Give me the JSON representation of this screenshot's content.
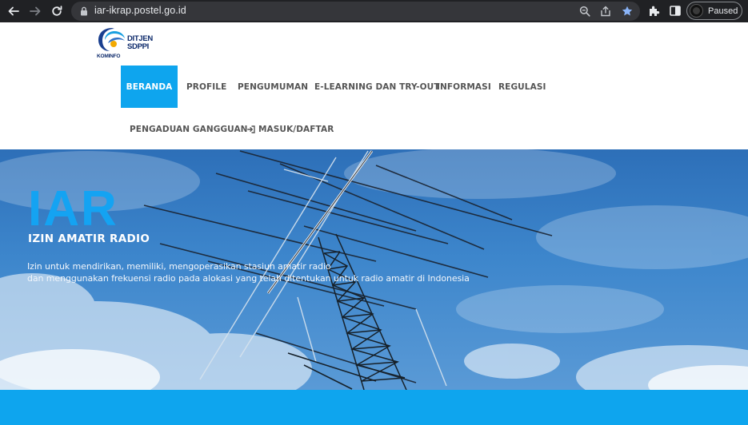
{
  "browser": {
    "url": "iar-ikrap.postel.go.id",
    "profile_status": "Paused"
  },
  "brand": {
    "line1": "DITJEN",
    "line2": "SDPPI",
    "org": "KOMINFO"
  },
  "nav": {
    "items": [
      {
        "label": "BERANDA",
        "active": true
      },
      {
        "label": "PROFILE"
      },
      {
        "label": "PENGUMUMAN"
      },
      {
        "label": "E-LEARNING DAN TRY-OUT"
      },
      {
        "label": "INFORMASI"
      },
      {
        "label": "REGULASI"
      },
      {
        "label": "PENGADUAN GANGGUAN"
      },
      {
        "label": "MASUK/DAFTAR",
        "icon": "sign-in-icon"
      }
    ]
  },
  "hero": {
    "title": "IAR",
    "subtitle": "IZIN AMATIR RADIO",
    "desc_line1": "Izin untuk mendirikan, memiliki, mengoperasikan stasiun amatir radio",
    "desc_line2": "dan menggunakan frekuensi radio pada alokasi yang telah ditentukan untuk radio amatir di Indonesia"
  },
  "colors": {
    "accent": "#0ea5ee",
    "menu_text": "#555555",
    "chrome_bg": "#202124"
  }
}
